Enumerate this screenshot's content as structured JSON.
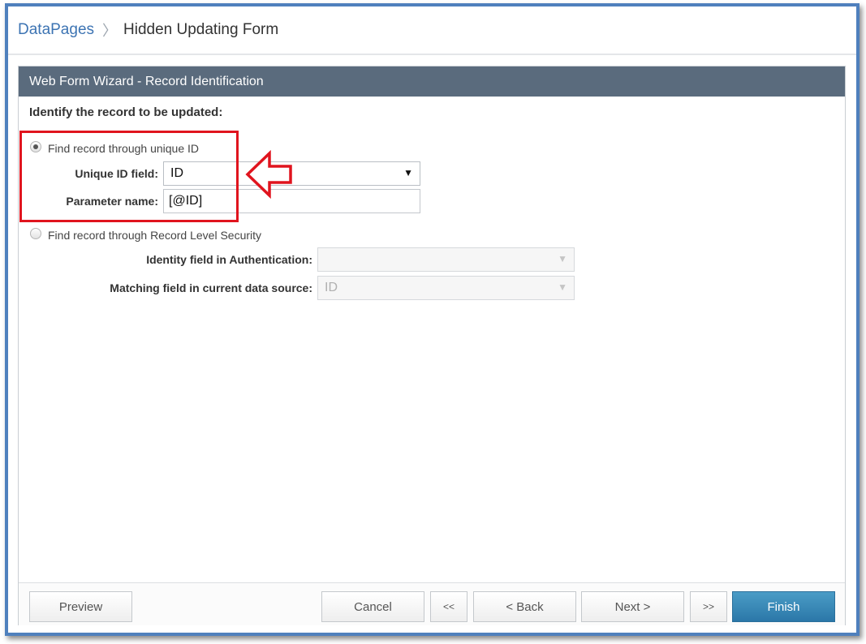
{
  "breadcrumb": {
    "root": "DataPages",
    "separator": "〉",
    "current": "Hidden Updating Form"
  },
  "wizard": {
    "title": "Web Form Wizard - Record Identification",
    "heading": "Identify the record to be updated:"
  },
  "option_unique_id": {
    "label": "Find record through unique ID",
    "selected": true,
    "unique_id_label": "Unique ID field:",
    "unique_id_value": "ID",
    "parameter_label": "Parameter name:",
    "parameter_value": "[@ID]"
  },
  "option_rls": {
    "label": "Find record through Record Level Security",
    "selected": false,
    "identity_label": "Identity field in Authentication:",
    "identity_value": "",
    "matching_label": "Matching field in current data source:",
    "matching_value": "ID"
  },
  "buttons": {
    "preview": "Preview",
    "cancel": "Cancel",
    "first": "<<",
    "back": "< Back",
    "next": "Next >",
    "last": ">>",
    "finish": "Finish"
  },
  "icons": {
    "dropdown": "chevron-down-icon",
    "annotation": "arrow-left-icon"
  },
  "colors": {
    "frame": "#4f80bd",
    "header": "#5a6b7d",
    "highlight": "#e0141e",
    "primary_button": "#2b77a8",
    "link": "#3d74b3"
  }
}
